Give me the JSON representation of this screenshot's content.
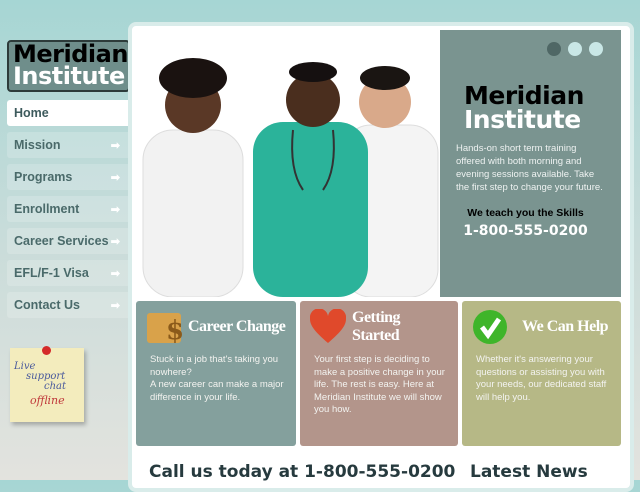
{
  "logo": {
    "line1": "Meridian",
    "line2": "Institute"
  },
  "nav": [
    {
      "label": "Home",
      "active": true
    },
    {
      "label": "Mission"
    },
    {
      "label": "Programs"
    },
    {
      "label": "Enrollment"
    },
    {
      "label": "Career Services"
    },
    {
      "label": "EFL/F-1 Visa"
    },
    {
      "label": "Contact Us"
    }
  ],
  "nav_arrow": "➡",
  "live_chat": {
    "line1": "Live",
    "line2": "support",
    "line3": "chat",
    "status": "offline"
  },
  "hero": {
    "title1": "Meridian",
    "title2": "Institute",
    "description": "Hands-on short term training offered with both morning and evening sessions available. Take the first step to change your future.",
    "tagline": "We teach you the Skills",
    "phone": "1-800-555-0200",
    "slides": 3,
    "active_slide": 1
  },
  "boxes": [
    {
      "title": "Career Change",
      "icon": "money-box-icon",
      "color": "#84a09d",
      "text1": "Stuck in a job that's taking you nowhere?",
      "text2": "A new career can make a major difference in your life."
    },
    {
      "title": "Getting Started",
      "icon": "heart-icon",
      "color": "#b3958b",
      "text1": "Your first step is deciding to make a positive change in your life. The rest is easy. Here at Meridian Institute we will show you how."
    },
    {
      "title": "We Can Help",
      "icon": "checkmark-icon",
      "color": "#b6b886",
      "text1": "Whether it's answering your questions or assisting you with your needs, our dedicated staff will help you."
    }
  ],
  "call_heading": "Call us today at 1-800-555-0200",
  "news_heading": "Latest News"
}
